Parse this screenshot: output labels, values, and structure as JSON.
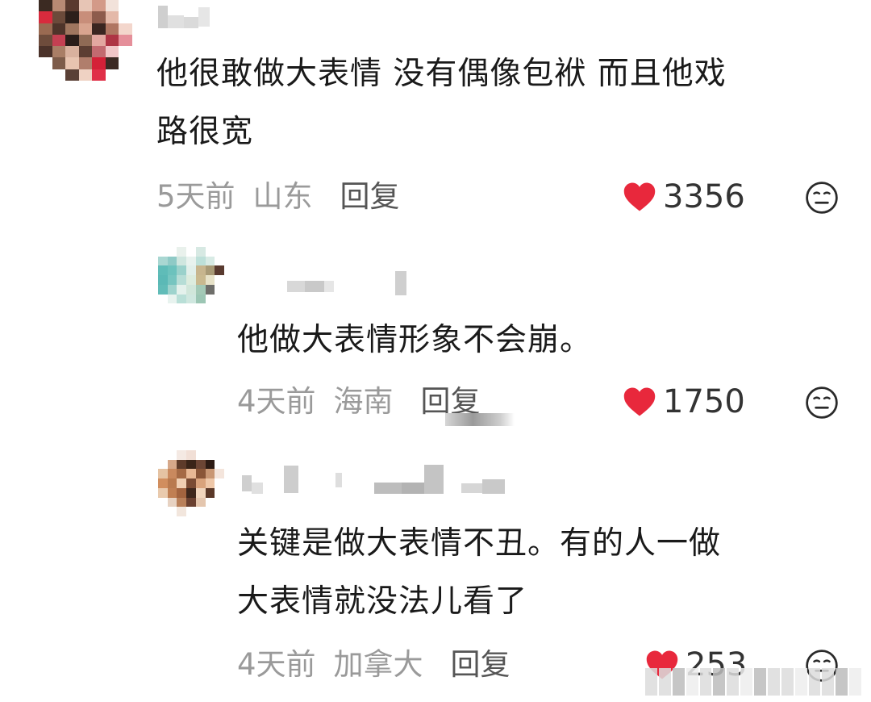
{
  "comments": [
    {
      "text": "他很敢做大表情 没有偶像包袱 而且他戏\n路很宽",
      "time": "5天前",
      "location": "山东",
      "reply_label": "回复",
      "likes": "3356"
    },
    {
      "text": "他做大表情形象不会崩。",
      "time": "4天前",
      "location": "海南",
      "reply_label": "回复",
      "likes": "1750"
    },
    {
      "text": "关键是做大表情不丑。有的人一做\n大表情就没法儿看了",
      "time": "4天前",
      "location": "加拿大",
      "reply_label": "回复",
      "likes": "253"
    }
  ],
  "icons": {
    "like": "heart-icon",
    "dislike": "neutral-face-icon"
  },
  "colors": {
    "heart": "#e8283c",
    "meta_text": "#9a9a9a",
    "body_text": "#1a1a1a"
  }
}
